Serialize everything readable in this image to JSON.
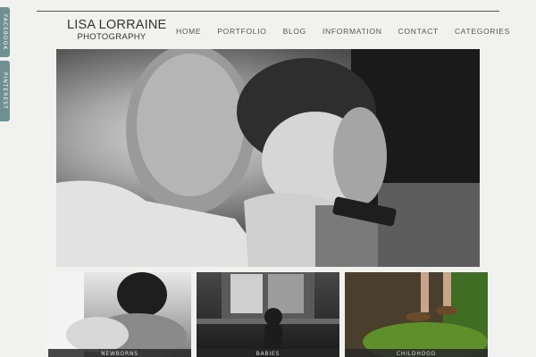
{
  "social": {
    "facebook_label": "FACEBOOK",
    "pinterest_label": "PINTEREST"
  },
  "header": {
    "logo_name": "LISA LORRAINE",
    "logo_sub": "PHOTOGRAPHY",
    "nav": [
      "HOME",
      "PORTFOLIO",
      "BLOG",
      "INFORMATION",
      "CONTACT",
      "CATEGORIES"
    ]
  },
  "gallery": {
    "captions": [
      "Newborns",
      "Babies",
      "Childhood"
    ]
  }
}
